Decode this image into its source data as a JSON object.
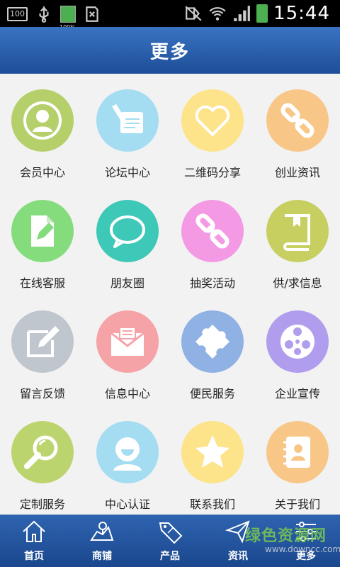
{
  "status_bar": {
    "time": "15:44",
    "left_badge": "100",
    "battery_percent": "100%"
  },
  "header": {
    "title": "更多"
  },
  "grid": {
    "items": [
      {
        "label": "会员中心",
        "icon": "user-icon",
        "color": "#b5cf6b"
      },
      {
        "label": "论坛中心",
        "icon": "write-icon",
        "color": "#a4dcf2"
      },
      {
        "label": "二维码分享",
        "icon": "heart-icon",
        "color": "#fde389"
      },
      {
        "label": "创业资讯",
        "icon": "link-icon",
        "color": "#f8c787"
      },
      {
        "label": "在线客服",
        "icon": "document-icon",
        "color": "#84dc7c"
      },
      {
        "label": "朋友圈",
        "icon": "chat-bubble-icon",
        "color": "#3ec8b7"
      },
      {
        "label": "抽奖活动",
        "icon": "link-icon",
        "color": "#f49ae4"
      },
      {
        "label": "供/求信息",
        "icon": "book-icon",
        "color": "#c6cf5f"
      },
      {
        "label": "留言反馈",
        "icon": "edit-icon",
        "color": "#bfc6cd"
      },
      {
        "label": "信息中心",
        "icon": "envelope-icon",
        "color": "#f6a3a8"
      },
      {
        "label": "便民服务",
        "icon": "puzzle-icon",
        "color": "#8fb1e3"
      },
      {
        "label": "企业宣传",
        "icon": "film-reel-icon",
        "color": "#b19ded"
      },
      {
        "label": "定制服务",
        "icon": "magnifier-icon",
        "color": "#bcd46e"
      },
      {
        "label": "中心认证",
        "icon": "smile-user-icon",
        "color": "#a4dcf2"
      },
      {
        "label": "联系我们",
        "icon": "star-icon",
        "color": "#fde389"
      },
      {
        "label": "关于我们",
        "icon": "contacts-icon",
        "color": "#f8c787"
      }
    ]
  },
  "bottom_nav": {
    "items": [
      {
        "label": "首页",
        "icon": "home-icon"
      },
      {
        "label": "商铺",
        "icon": "map-icon"
      },
      {
        "label": "产品",
        "icon": "sale-tag-icon"
      },
      {
        "label": "资讯",
        "icon": "send-icon"
      },
      {
        "label": "更多",
        "icon": "settings-sliders-icon"
      }
    ]
  },
  "watermark": {
    "text": "绿色资源网",
    "url": "www.downcc.com"
  }
}
